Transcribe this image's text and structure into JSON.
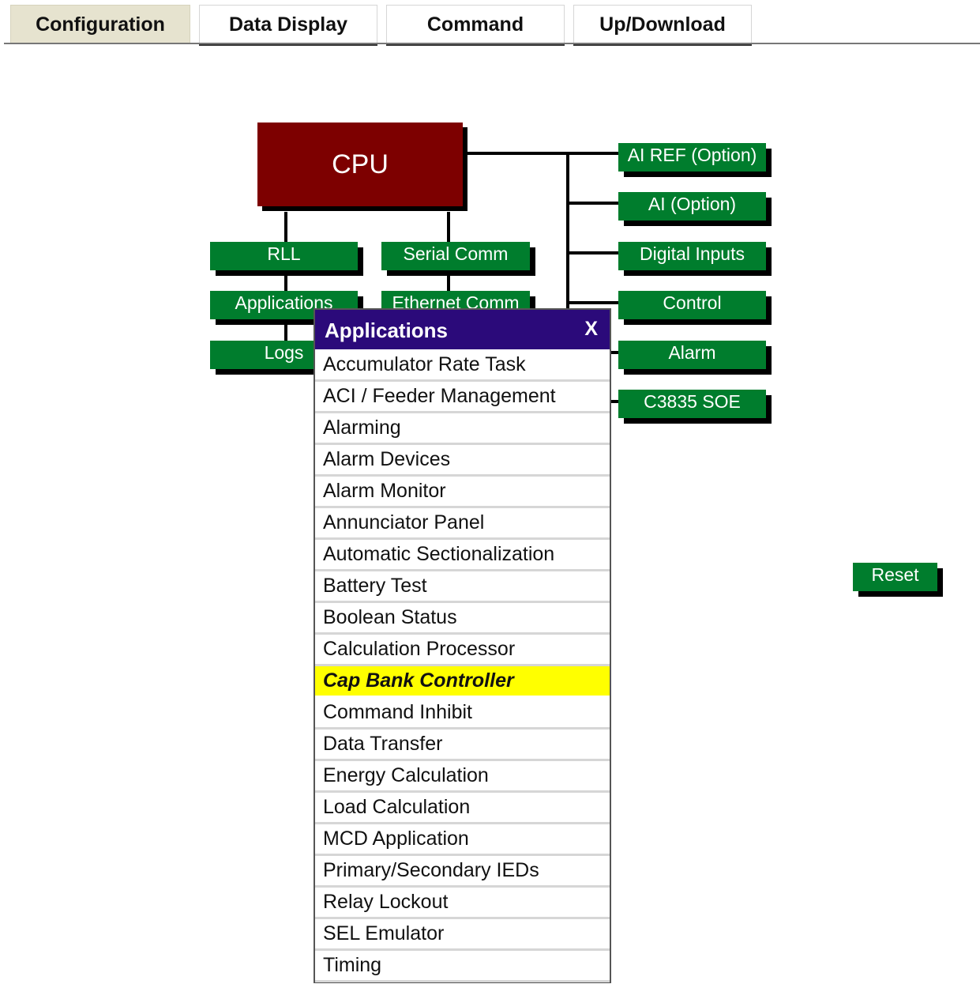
{
  "tabs": [
    {
      "label": "Configuration",
      "active": true
    },
    {
      "label": "Data Display",
      "active": false
    },
    {
      "label": "Command",
      "active": false
    },
    {
      "label": "Up/Download",
      "active": false
    }
  ],
  "diagram": {
    "cpu_label": "CPU",
    "left_modules": [
      "RLL",
      "Applications",
      "Logs"
    ],
    "middle_modules": [
      "Serial Comm",
      "Ethernet Comm"
    ],
    "right_modules": [
      "AI REF (Option)",
      "AI (Option)",
      "Digital Inputs",
      "Control",
      "Alarm",
      "C3835 SOE"
    ],
    "reset_label": "Reset"
  },
  "popup": {
    "title": "Applications",
    "close_label": "X",
    "items": [
      "Accumulator Rate Task",
      "ACI / Feeder Management",
      "Alarming",
      "Alarm Devices",
      "Alarm Monitor",
      "Annunciator Panel",
      "Automatic Sectionalization",
      "Battery Test",
      "Boolean Status",
      "Calculation Processor",
      "Cap Bank Controller",
      "Command Inhibit",
      "Data Transfer",
      "Energy Calculation",
      "Load Calculation",
      "MCD Application",
      "Primary/Secondary IEDs",
      "Relay Lockout",
      "SEL Emulator",
      "Timing"
    ],
    "highlighted_item": "Cap Bank Controller"
  },
  "colors": {
    "cpu": "#7d0000",
    "module": "#007d2d",
    "popup_header": "#2b0a7a",
    "highlight": "#ffff00",
    "active_tab": "#e6e3cf"
  }
}
